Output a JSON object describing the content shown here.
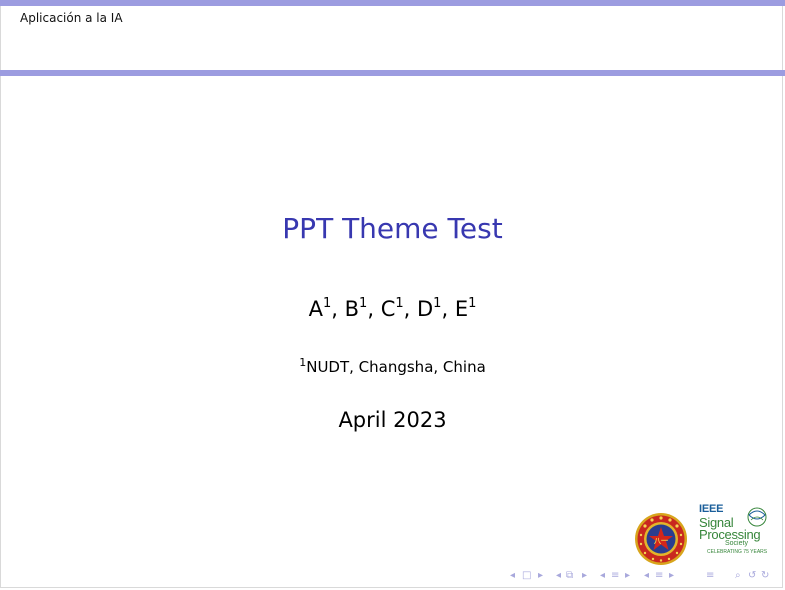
{
  "header": {
    "short_title": "Aplicación a la IA"
  },
  "title_slide": {
    "title": "PPT Theme Test",
    "authors": [
      {
        "name": "A",
        "affil": "1"
      },
      {
        "name": "B",
        "affil": "1"
      },
      {
        "name": "C",
        "affil": "1"
      },
      {
        "name": "D",
        "affil": "1"
      },
      {
        "name": "E",
        "affil": "1"
      }
    ],
    "institute": {
      "affil": "1",
      "text": "NUDT, Changsha, China"
    },
    "date": "April 2023"
  },
  "logos": {
    "ieee_word": "IEEE",
    "ieee_line1": "Signal",
    "ieee_line2": "Processing",
    "ieee_line3": "Society",
    "ieee_line4": "CELEBRATING 75 YEARS"
  },
  "nav_icons": [
    "nav-arrow-left-icon",
    "nav-frame-icon",
    "nav-arrow-right-icon",
    "nav-arrow-left-icon",
    "nav-subsection-icon",
    "nav-arrow-right-icon",
    "nav-arrow-left-icon",
    "nav-section-icon",
    "nav-arrow-right-icon",
    "nav-arrow-left-icon",
    "nav-section-icon",
    "nav-arrow-right-icon",
    "nav-toc-icon",
    "nav-search-icon",
    "nav-back-icon",
    "nav-forward-icon"
  ],
  "colors": {
    "accent": "#3838b0",
    "rule": "#9c9ce0",
    "nav": "#a8a8dc"
  }
}
